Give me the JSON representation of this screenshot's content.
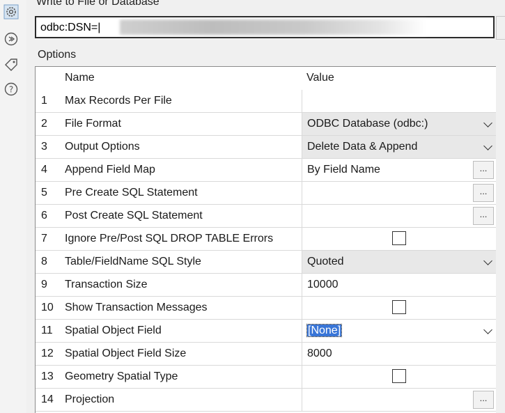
{
  "destination": {
    "label": "Write to File or Database",
    "value": "odbc:DSN=|"
  },
  "options": {
    "label": "Options",
    "header": {
      "name": "Name",
      "value": "Value"
    },
    "rows": [
      {
        "num": "1",
        "name": "Max Records Per File",
        "value": ""
      },
      {
        "num": "2",
        "name": "File Format",
        "value": "ODBC Database (odbc:)"
      },
      {
        "num": "3",
        "name": "Output Options",
        "value": "Delete Data & Append"
      },
      {
        "num": "4",
        "name": "Append Field Map",
        "value": "By Field Name",
        "button": "..."
      },
      {
        "num": "5",
        "name": "Pre Create SQL Statement",
        "value": "",
        "button": "..."
      },
      {
        "num": "6",
        "name": "Post Create SQL Statement",
        "value": "",
        "button": "..."
      },
      {
        "num": "7",
        "name": "Ignore Pre/Post SQL DROP TABLE Errors",
        "checked": false
      },
      {
        "num": "8",
        "name": "Table/FieldName SQL Style",
        "value": "Quoted"
      },
      {
        "num": "9",
        "name": "Transaction Size",
        "value": "10000"
      },
      {
        "num": "10",
        "name": "Show Transaction Messages",
        "checked": false
      },
      {
        "num": "11",
        "name": "Spatial Object Field",
        "value": "[None]"
      },
      {
        "num": "12",
        "name": "Spatial Object Field Size",
        "value": "8000"
      },
      {
        "num": "13",
        "name": "Geometry Spatial Type",
        "checked": false
      },
      {
        "num": "14",
        "name": "Projection",
        "value": "",
        "button": "..."
      }
    ]
  },
  "icons": [
    "gear-icon",
    "arrow-circle-icon",
    "tag-icon",
    "help-icon"
  ]
}
